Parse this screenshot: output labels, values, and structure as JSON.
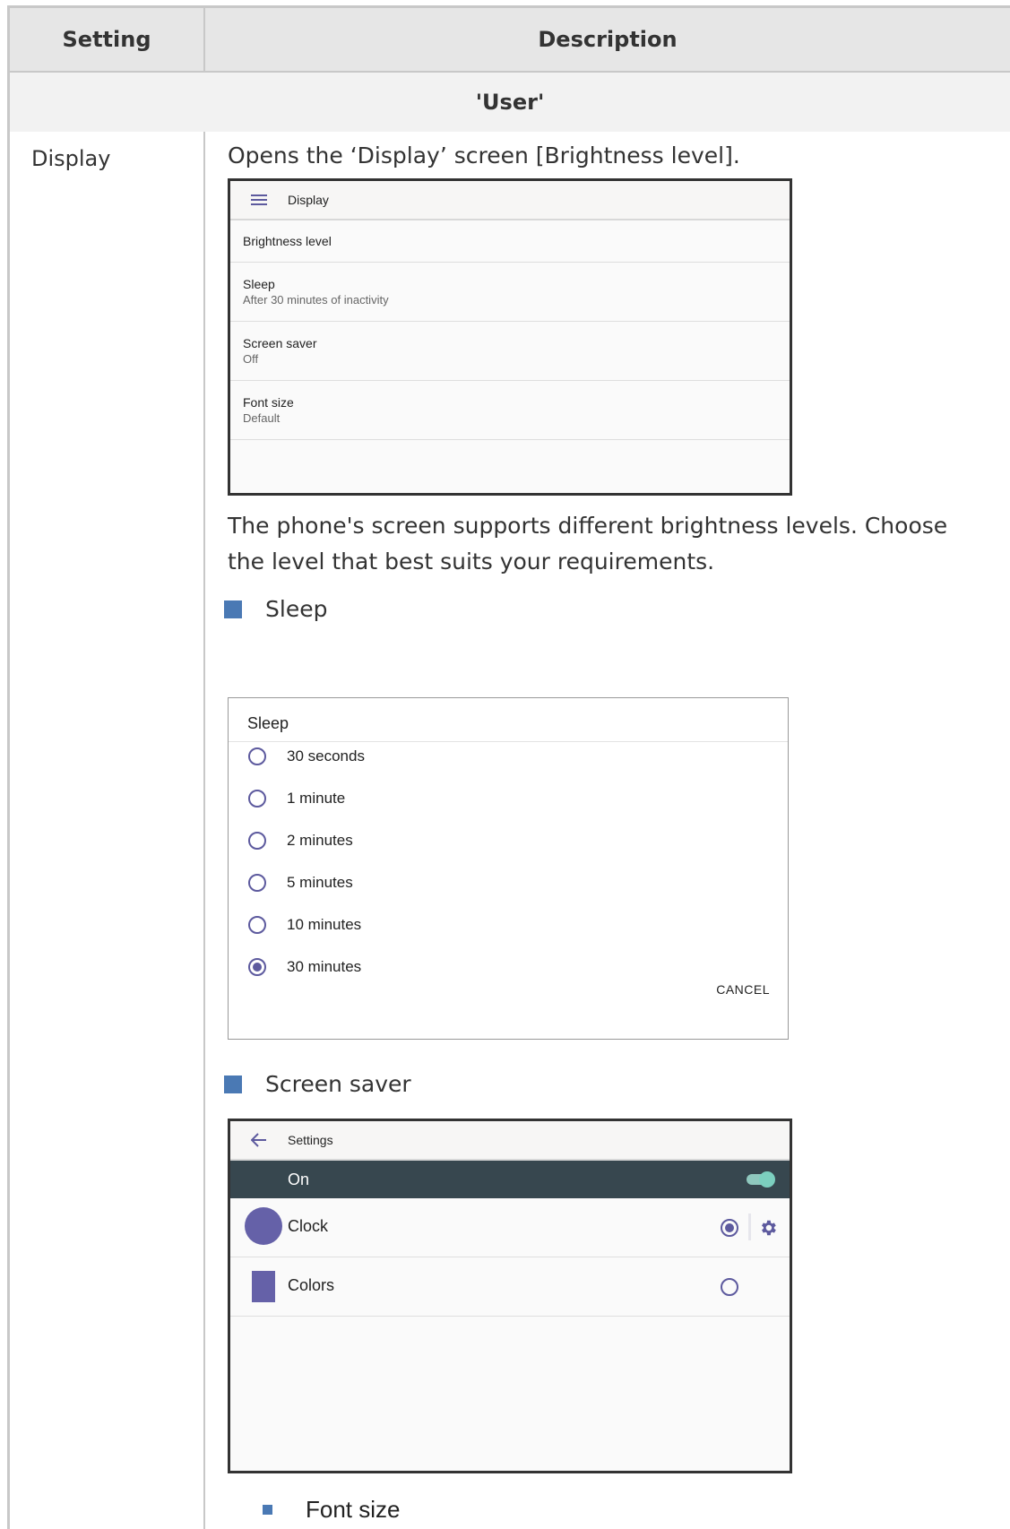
{
  "table": {
    "header_setting": "Setting",
    "header_description": "Description",
    "group_label": "'User'",
    "row_setting": "Display"
  },
  "description": {
    "intro": "Opens the ‘Display’ screen [Brightness level].",
    "brightness_text": "The phone's screen supports different brightness levels. Choose the level that best suits your requirements.",
    "sleep_bullet": "Sleep",
    "screensaver_bullet": "Screen saver",
    "fontsize_bullet": "Font size"
  },
  "display_screen": {
    "title": "Display",
    "items": [
      {
        "title": "Brightness level",
        "subtitle": ""
      },
      {
        "title": "Sleep",
        "subtitle": "After 30 minutes of inactivity"
      },
      {
        "title": "Screen saver",
        "subtitle": "Off"
      },
      {
        "title": "Font size",
        "subtitle": "Default"
      }
    ]
  },
  "sleep_dialog": {
    "title": "Sleep",
    "options": [
      "30 seconds",
      "1 minute",
      "2 minutes",
      "5 minutes",
      "10 minutes",
      "30 minutes"
    ],
    "selected": "30 minutes",
    "cancel": "CANCEL"
  },
  "screensaver_screen": {
    "title": "Settings",
    "toggle_label": "On",
    "toggle_on": true,
    "items": [
      {
        "label": "Clock",
        "selected": true
      },
      {
        "label": "Colors",
        "selected": false
      }
    ]
  },
  "colors": {
    "accent": "#5d5a9e",
    "bullet": "#4a79b4",
    "dark_bar": "#37474f",
    "toggle": "#7ccfbf"
  }
}
